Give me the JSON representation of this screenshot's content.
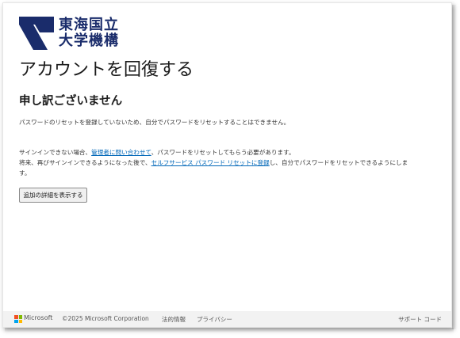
{
  "org": {
    "logo_line1": "東海国立",
    "logo_line2": "大学機構",
    "logo_color": "#1a2c6b"
  },
  "page": {
    "title": "アカウントを回復する",
    "subtitle": "申し訳ございません",
    "message": "パスワードのリセットを登録していないため、自分でパスワードをリセットすることはできません。",
    "line2_prefix": "サインインできない場合、",
    "line2_link": "管理者に問い合わせて",
    "line2_suffix": "、パスワードをリセットしてもらう必要があります。",
    "line3_prefix": "将来、再びサインインできるようになった後で、",
    "line3_link": "セルフサービス パスワード リセットに登録",
    "line3_suffix": "し、自分でパスワードをリセットできるようにしま",
    "line4": "す。",
    "details_button": "追加の詳細を表示する",
    "link_color": "#0067b8"
  },
  "footer": {
    "brand": "Microsoft",
    "copyright": "©2025 Microsoft Corporation",
    "legal": "法的情報",
    "privacy": "プライバシー",
    "support_code": "サポート コード",
    "ms_colors": [
      "#f25022",
      "#7fba00",
      "#00a4ef",
      "#ffb900"
    ]
  }
}
